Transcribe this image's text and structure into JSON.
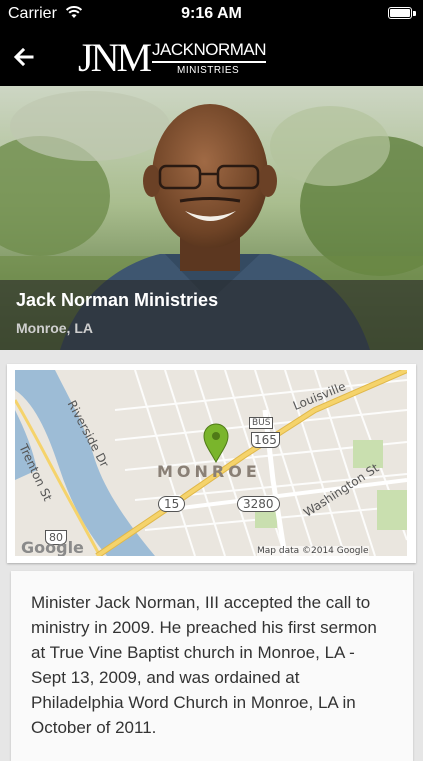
{
  "status_bar": {
    "carrier": "Carrier",
    "time": "9:16 AM"
  },
  "nav": {
    "back_icon": "arrow-left-icon",
    "logo_monogram": "JNM",
    "logo_name": "JACKNORMAN",
    "logo_subtitle": "MINISTRIES"
  },
  "hero": {
    "title": "Jack Norman Ministries",
    "subtitle": "Monroe, LA"
  },
  "map": {
    "city_label": "MONROE",
    "streets": [
      "Riverside Dr",
      "Trenton St",
      "Washington St",
      "Louisville"
    ],
    "shields": {
      "bus": "BUS",
      "route_165": "165",
      "route_15": "15",
      "route_3280": "3280",
      "route_80": "80"
    },
    "watermark": "Google",
    "attribution": "Map data ©2014 Google"
  },
  "description": "Minister Jack Norman, III accepted the call to ministry in 2009. He preached his first sermon at True Vine Baptist church in Monroe, LA - Sept 13, 2009, and was ordained at Philadelphia Word Church in Monroe, LA in October of 2011.",
  "colors": {
    "nav_bg": "#000000",
    "water": "#9dbcd6",
    "highway": "#f5d36b",
    "park": "#c9dfaf",
    "pin": "#7ab52c"
  }
}
